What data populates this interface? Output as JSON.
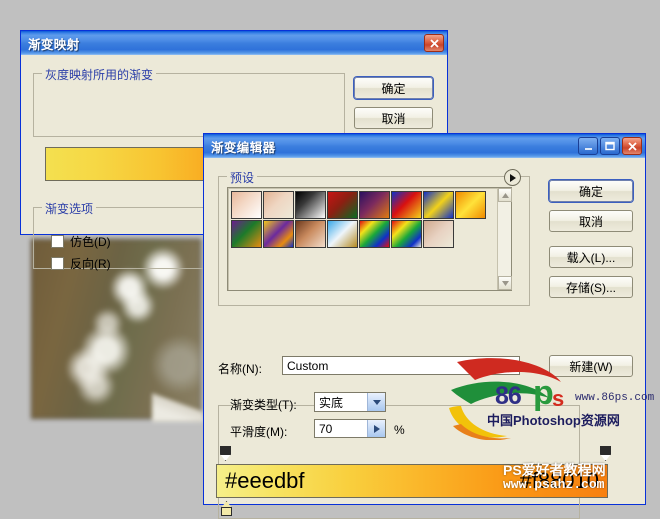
{
  "desktop": {
    "background_color": "#c0c0c0"
  },
  "photo": {
    "name": "blurred-nature-photo"
  },
  "dialog_gradient_map": {
    "title": "渐变映射",
    "close_label": "✕",
    "group_map_label": "灰度映射所用的渐变",
    "gradient_preview": {
      "from": "#f4e04f",
      "to": "#f98208",
      "dropdown_arrow": "▼"
    },
    "group_options_label": "渐变选项",
    "checkboxes": [
      {
        "label": "仿色(D)",
        "checked": false
      },
      {
        "label": "反向(R)",
        "checked": false
      }
    ],
    "buttons": [
      {
        "label": "确定",
        "default": true
      },
      {
        "label": "取消",
        "default": false
      }
    ]
  },
  "dialog_gradient_editor": {
    "title": "渐变编辑器",
    "minimize_label": "_",
    "maximize_label": "□",
    "close_label": "✕",
    "group_presets_label": "预设",
    "presets_menu_arrow": "▶",
    "scroll_up_arrow": "▲",
    "scroll_down_arrow": "▼",
    "presets": [
      {
        "name": "foreground-to-background",
        "css": "linear-gradient(135deg,#e8b79a 0%,#f3d7c4 40%,#ffffff 100%)"
      },
      {
        "name": "foreground-to-transparent",
        "css": "linear-gradient(135deg,#e2b393 0%,#efd6c2 45%,rgba(255,255,255,0) 100%)"
      },
      {
        "name": "black-white",
        "css": "linear-gradient(135deg,#000000 0%,#3a3a3a 35%,#ffffff 100%)"
      },
      {
        "name": "red-green",
        "css": "linear-gradient(135deg,#c81414 0%,#8c1f12 45%,#0b6b22 100%)"
      },
      {
        "name": "violet-orange",
        "css": "linear-gradient(135deg,#2b1060 0%,#7b2a5e 45%,#e07a10 100%)"
      },
      {
        "name": "blue-red-yellow",
        "css": "linear-gradient(135deg,#1030c8 0%,#d81010 45%,#f2d21a 100%)"
      },
      {
        "name": "blue-yellow-blue",
        "css": "linear-gradient(135deg,#1030c8 0%,#f2d21a 50%,#1030c8 100%)"
      },
      {
        "name": "orange-yellow-orange",
        "css": "linear-gradient(135deg,#f08a00 0%,#ffe23a 50%,#f08a00 100%)"
      },
      {
        "name": "violet-green-orange",
        "css": "linear-gradient(135deg,#6b1c8e 0%,#1c7a2a 45%,#e88c10 100%)"
      },
      {
        "name": "yellow-violet-orange-blue",
        "css": "linear-gradient(135deg,#f2c81a 0%,#6b2a9e 45%,#e88c10 75%,#1030c8 100%)"
      },
      {
        "name": "copper",
        "css": "linear-gradient(135deg,#6d3a1e 0%,#c98a5e 45%,#f2ddcc 100%)"
      },
      {
        "name": "chrome",
        "css": "linear-gradient(135deg,#3aa8e8 0%,#eef5fb 48%,#b58a20 100%)"
      },
      {
        "name": "spectrum",
        "css": "linear-gradient(135deg,#e01010 0%,#f2e21a 25%,#1aa83a 50%,#1030c8 75%,#e01010 100%)"
      },
      {
        "name": "transparent-rainbow",
        "css": "linear-gradient(135deg,#e01010 0%,#f2e21a 30%,#1aa83a 55%,#1030c8 80%,rgba(255,255,255,0) 100%)"
      },
      {
        "name": "transparent-stripes",
        "css": "linear-gradient(135deg,#cfa98e 0%,#e8d2c2 50%,rgba(255,255,255,0) 100%)"
      }
    ],
    "buttons": [
      {
        "label": "确定",
        "default": true
      },
      {
        "label": "取消",
        "default": false
      },
      {
        "label": "载入(L)...",
        "default": false
      },
      {
        "label": "存储(S)...",
        "default": false
      },
      {
        "label": "新建(W)",
        "default": false
      }
    ],
    "name_label": "名称(N):",
    "name_value": "Custom",
    "gradient_type_label": "渐变类型(T):",
    "gradient_type_value": "实底",
    "gradient_type_arrow": "▼",
    "smoothness_label": "平滑度(M):",
    "smoothness_value": "70",
    "smoothness_spin_arrow": "▶",
    "smoothness_unit": "%",
    "gradient_bar": {
      "left_hex": "#eeedbf",
      "right_hex": "#f88010",
      "stops": [
        {
          "type": "opacity",
          "position": "left"
        },
        {
          "type": "opacity",
          "position": "right"
        },
        {
          "type": "color",
          "position": "left",
          "color": "#f2e9a8"
        }
      ]
    }
  },
  "watermark_logo": {
    "text_86": "86",
    "text_p": "p",
    "text_s": "s",
    "url": "www.86ps.com",
    "subtitle": "中国Photoshop资源网"
  },
  "watermark_bottom": {
    "line1": "PS爱好者教程网",
    "line2": "www.psahz.com"
  }
}
